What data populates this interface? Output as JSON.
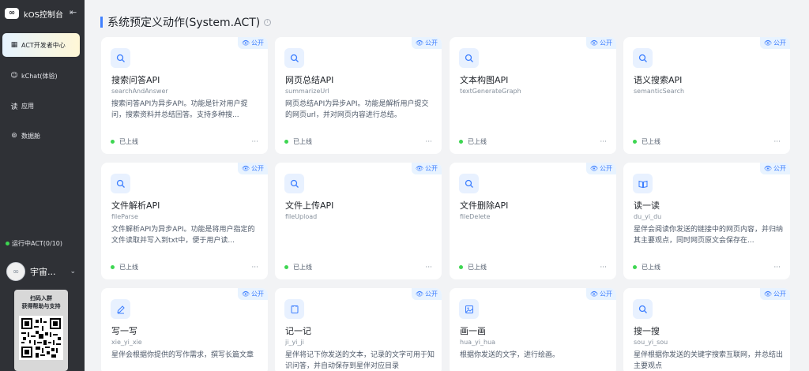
{
  "sidebar": {
    "brand": {
      "logo_glyph": "∞",
      "title": "kOS控制台"
    },
    "nav": [
      {
        "label": "ACT开发者中心",
        "icon": "grid-icon",
        "active": true
      },
      {
        "label": "kChat(体验)",
        "icon": "chat-icon",
        "active": false
      },
      {
        "label": "应用",
        "icon": "app-icon",
        "active": false
      },
      {
        "label": "数据舱",
        "icon": "database-icon",
        "active": false
      }
    ],
    "running": "运行中ACT(0/10)",
    "user": {
      "name": "宇宙..."
    },
    "qr": {
      "line1": "扫码入群",
      "line2": "获得帮助与支持"
    }
  },
  "header": {
    "title": "系统预定义动作(System.ACT)"
  },
  "cards": [
    {
      "title": "搜索问答API",
      "subtitle": "searchAndAnswer",
      "desc": "搜索问答API为异步API。功能是针对用户提问，搜索资料并总结回答。支持多种搜...",
      "status": "已上线",
      "badge": "公开",
      "icon": "search-icon"
    },
    {
      "title": "网页总结API",
      "subtitle": "summarizeUrl",
      "desc": "网页总结API为异步API。功能是解析用户提交的网页url，并对网页内容进行总结。",
      "status": "已上线",
      "badge": "公开",
      "icon": "search-icon"
    },
    {
      "title": "文本构图API",
      "subtitle": "textGenerateGraph",
      "desc": "",
      "status": "已上线",
      "badge": "公开",
      "icon": "search-icon"
    },
    {
      "title": "语义搜索API",
      "subtitle": "semanticSearch",
      "desc": "",
      "status": "已上线",
      "badge": "公开",
      "icon": "search-icon"
    },
    {
      "title": "文件解析API",
      "subtitle": "fileParse",
      "desc": "文件解析API为异步API。功能是将用户指定的文件读取并写入到txt中，便于用户读...",
      "status": "已上线",
      "badge": "公开",
      "icon": "search-icon"
    },
    {
      "title": "文件上传API",
      "subtitle": "fileUpload",
      "desc": "",
      "status": "已上线",
      "badge": "公开",
      "icon": "search-icon"
    },
    {
      "title": "文件删除API",
      "subtitle": "fileDelete",
      "desc": "",
      "status": "已上线",
      "badge": "公开",
      "icon": "search-icon"
    },
    {
      "title": "读一读",
      "subtitle": "du_yi_du",
      "desc": "星伴会阅读你发送的链接中的网页内容，并归纳其主要观点，同时网页原文会保存在...",
      "status": "已上线",
      "badge": "公开",
      "icon": "book-icon"
    },
    {
      "title": "写一写",
      "subtitle": "xie_yi_xie",
      "desc": "星伴会根据你提供的写作需求，撰写长篇文章",
      "status": "",
      "badge": "公开",
      "icon": "pen-icon"
    },
    {
      "title": "记一记",
      "subtitle": "ji_yi_ji",
      "desc": "星伴将记下你发送的文本，记录的文字可用于知识问答，并自动保存到星伴对应目录",
      "status": "",
      "badge": "公开",
      "icon": "note-icon"
    },
    {
      "title": "画一画",
      "subtitle": "hua_yi_hua",
      "desc": "根据你发送的文字，进行绘画。",
      "status": "",
      "badge": "公开",
      "icon": "image-icon"
    },
    {
      "title": "搜一搜",
      "subtitle": "sou_yi_sou",
      "desc": "星伴根据你发送的关键字搜索互联网，并总结出主要观点",
      "status": "",
      "badge": "公开",
      "icon": "search-icon"
    }
  ],
  "more_glyph": "···",
  "colors": {
    "accent": "#3c7eff",
    "online": "#3dd651",
    "sidebar_bg": "#2f3136"
  }
}
